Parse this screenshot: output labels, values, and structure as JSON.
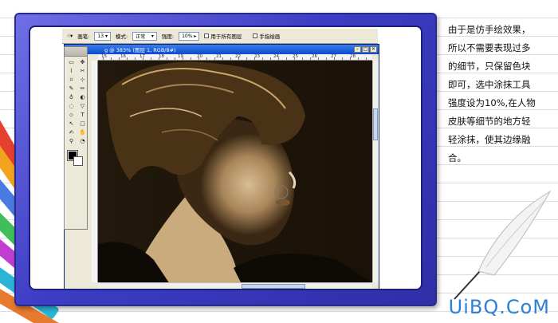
{
  "options_bar": {
    "brush_label": "画笔:",
    "brush_size": "13",
    "mode_label": "模式:",
    "mode_value": "正常",
    "strength_label": "强度:",
    "strength_value": "10%",
    "all_layers_label": "用于所有图层",
    "finger_paint_label": "手指绘画"
  },
  "document": {
    "title": "g @ 383% (图层 1, RGB/8#)",
    "ruler_marks": [
      "15",
      "16",
      "17",
      "18",
      "19",
      "20",
      "21",
      "22",
      "23",
      "24",
      "25",
      "26",
      "27",
      "28"
    ]
  },
  "toolbox": {
    "tools": [
      "▭",
      "✥",
      "⌇",
      "✂",
      "⌑",
      "⊹",
      "✎",
      "✏",
      "♁",
      "◐",
      "◌",
      "▽",
      "⬦",
      "T",
      "↖",
      "▢",
      "✍",
      "✋",
      "⚲",
      "◔"
    ]
  },
  "description": [
    "由于是仿手绘效果，",
    "所以不需要表现过多",
    "的细节，只保留色块",
    "即可，选中涂抹工具",
    "强度设为10%,在人物",
    "皮肤等细节的地方轻",
    "轻涂抹，使其边缘融",
    "合。"
  ],
  "watermark": "UiBQ.CoM",
  "colors": {
    "frame": "#3c3cc4",
    "title_bar": "#0a4ad0",
    "watermark": "#2f7fd8"
  }
}
